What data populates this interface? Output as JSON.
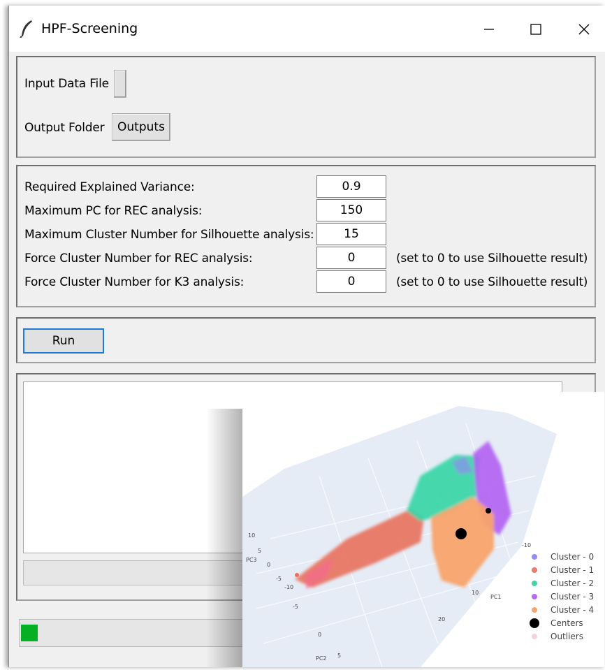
{
  "window": {
    "title": "HPF-Screening",
    "controls": {
      "minimize": "—",
      "maximize": "☐",
      "close": "✕"
    }
  },
  "files": {
    "input_label": "Input Data File",
    "input_button": "",
    "output_label": "Output Folder",
    "output_button": "Outputs"
  },
  "params": [
    {
      "label": "Required Explained Variance:",
      "value": "0.9",
      "note": ""
    },
    {
      "label": "Maximum PC for REC analysis:",
      "value": "150",
      "note": ""
    },
    {
      "label": "Maximum Cluster Number for Silhouette analysis:",
      "value": "15",
      "note": ""
    },
    {
      "label": "Force Cluster Number for REC analysis:",
      "value": "0",
      "note": "(set to 0 to use Silhouette result)"
    },
    {
      "label": "Force Cluster Number for K3 analysis:",
      "value": "0",
      "note": "(set to 0 to use Silhouette result)"
    }
  ],
  "run_label": "Run",
  "progress_fraction": 0.03,
  "progress_color": "#06b025",
  "plot": {
    "axis_labels": {
      "pc1": "PC1",
      "pc2": "PC2",
      "pc3": "PC3"
    },
    "pc1_ticks": [
      "-10",
      "10",
      "20"
    ],
    "pc2_ticks": [
      "-10",
      "-5",
      "0",
      "5"
    ],
    "pc3_ticks": [
      "10",
      "5",
      "0",
      "-5"
    ],
    "legend": [
      {
        "label": "Cluster  - 0",
        "color": "#8e8ff0"
      },
      {
        "label": "Cluster  - 1",
        "color": "#ef7a6a"
      },
      {
        "label": "Cluster  - 2",
        "color": "#3fd4a6"
      },
      {
        "label": "Cluster  - 3",
        "color": "#b56bf2"
      },
      {
        "label": "Cluster  - 4",
        "color": "#f8a56d"
      },
      {
        "label": "Centers",
        "color": "#000000"
      },
      {
        "label": "Outliers",
        "color": "#f8d0d8"
      }
    ]
  }
}
